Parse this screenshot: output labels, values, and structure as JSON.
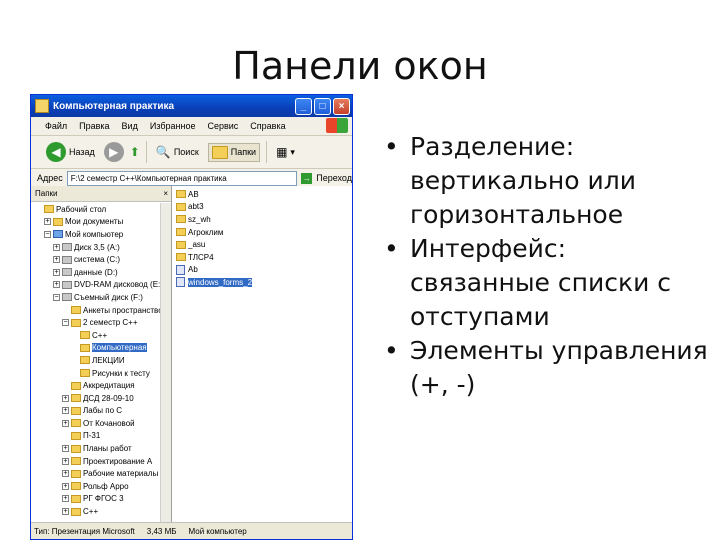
{
  "slide": {
    "title": "Панели окон",
    "bullets": [
      "Разделение: вертикально или горизонтальное",
      "Интерфейс: связанные списки с отступами",
      "Элементы управления  (+, -)"
    ]
  },
  "window": {
    "title": "Компьютерная практика",
    "controls": {
      "minimize": "_",
      "maximize": "□",
      "close": "×"
    },
    "menu": [
      "Файл",
      "Правка",
      "Вид",
      "Избранное",
      "Сервис",
      "Справка"
    ],
    "toolbar": {
      "back_label": "Назад",
      "search_label": "Поиск",
      "folders_label": "Папки",
      "views_label": "▾"
    },
    "address": {
      "label": "Адрес",
      "value": "F:\\2 семестр С++\\Компьютерная практика",
      "go_label": "Переход"
    },
    "left_pane": {
      "header": "Папки",
      "close": "×",
      "tree": [
        {
          "label": "Рабочий стол",
          "level": 0,
          "toggle": "",
          "icon": "folder"
        },
        {
          "label": "Мои документы",
          "level": 1,
          "toggle": "+",
          "icon": "folder"
        },
        {
          "label": "Мой компьютер",
          "level": 1,
          "toggle": "−",
          "icon": "pc"
        },
        {
          "label": "Диск 3,5 (A:)",
          "level": 2,
          "toggle": "+",
          "icon": "drive"
        },
        {
          "label": "система (C:)",
          "level": 2,
          "toggle": "+",
          "icon": "drive"
        },
        {
          "label": "данные (D:)",
          "level": 2,
          "toggle": "+",
          "icon": "drive"
        },
        {
          "label": "DVD-RAM дисковод (E:)",
          "level": 2,
          "toggle": "+",
          "icon": "drive"
        },
        {
          "label": "Съемный диск (F:)",
          "level": 2,
          "toggle": "−",
          "icon": "drive"
        },
        {
          "label": "Анкеты пространство",
          "level": 3,
          "toggle": "",
          "icon": "folder"
        },
        {
          "label": "2 семестр С++",
          "level": 3,
          "toggle": "−",
          "icon": "folder"
        },
        {
          "label": "C++",
          "level": 4,
          "toggle": "",
          "icon": "folder"
        },
        {
          "label": "Компьютерная",
          "level": 4,
          "toggle": "",
          "icon": "folder",
          "selected": true
        },
        {
          "label": "ЛЕКЦИИ",
          "level": 4,
          "toggle": "",
          "icon": "folder"
        },
        {
          "label": "Рисунки к тесту",
          "level": 4,
          "toggle": "",
          "icon": "folder"
        },
        {
          "label": "Аккредитация",
          "level": 3,
          "toggle": "",
          "icon": "folder"
        },
        {
          "label": "ДСД 28-09-10",
          "level": 3,
          "toggle": "+",
          "icon": "folder"
        },
        {
          "label": "Лабы по С",
          "level": 3,
          "toggle": "+",
          "icon": "folder"
        },
        {
          "label": "От Кочановой",
          "level": 3,
          "toggle": "+",
          "icon": "folder"
        },
        {
          "label": "П-31",
          "level": 3,
          "toggle": "",
          "icon": "folder"
        },
        {
          "label": "Планы работ",
          "level": 3,
          "toggle": "+",
          "icon": "folder"
        },
        {
          "label": "Проектирование А",
          "level": 3,
          "toggle": "+",
          "icon": "folder"
        },
        {
          "label": "Рабочие материалы",
          "level": 3,
          "toggle": "+",
          "icon": "folder"
        },
        {
          "label": "Рольф Арро",
          "level": 3,
          "toggle": "+",
          "icon": "folder"
        },
        {
          "label": "РГ ФГОС 3",
          "level": 3,
          "toggle": "+",
          "icon": "folder"
        },
        {
          "label": "С++",
          "level": 3,
          "toggle": "+",
          "icon": "folder"
        }
      ]
    },
    "right_pane": {
      "files": [
        {
          "label": "AB",
          "icon": "folder"
        },
        {
          "label": "abt3",
          "icon": "folder"
        },
        {
          "label": "sz_wh",
          "icon": "folder"
        },
        {
          "label": "Агроклим",
          "icon": "folder"
        },
        {
          "label": "_asu",
          "icon": "folder"
        },
        {
          "label": "ТЛСР4",
          "icon": "folder"
        },
        {
          "label": "Ab",
          "icon": "doc"
        },
        {
          "label": "windows_forms_2",
          "icon": "doc",
          "selected": true
        }
      ]
    },
    "status": {
      "type": "Тип: Презентация Microsoft",
      "size": "3,43 МБ",
      "location": "Мой компьютер"
    }
  }
}
